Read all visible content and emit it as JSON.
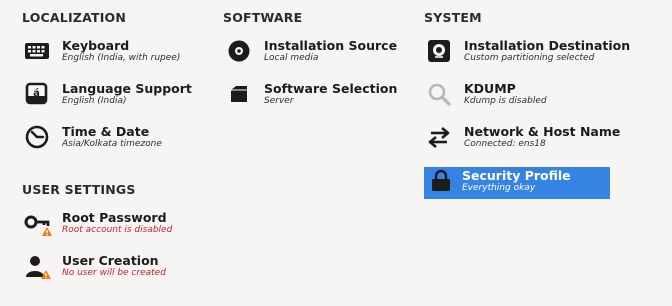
{
  "sections": {
    "localization": "LOCALIZATION",
    "software": "SOFTWARE",
    "system": "SYSTEM",
    "user_settings": "USER SETTINGS"
  },
  "spokes": {
    "keyboard": {
      "label": "Keyboard",
      "status": "English (India, with rupee)",
      "icon": "keyboard-icon"
    },
    "language": {
      "label": "Language Support",
      "status": "English (India)",
      "icon": "language-icon"
    },
    "time": {
      "label": "Time & Date",
      "status": "Asia/Kolkata timezone",
      "icon": "clock-icon"
    },
    "install_source": {
      "label": "Installation Source",
      "status": "Local media",
      "icon": "disc-icon"
    },
    "software_selection": {
      "label": "Software Selection",
      "status": "Server",
      "icon": "package-icon"
    },
    "install_dest": {
      "label": "Installation Destination",
      "status": "Custom partitioning selected",
      "icon": "drive-icon"
    },
    "kdump": {
      "label": "KDUMP",
      "status": "Kdump is disabled",
      "icon": "magnifier-icon"
    },
    "network": {
      "label": "Network & Host Name",
      "status": "Connected: ens18",
      "icon": "network-arrows-icon"
    },
    "security": {
      "label": "Security Profile",
      "status": "Everything okay",
      "icon": "lock-icon"
    },
    "root_password": {
      "label": "Root Password",
      "status": "Root account is disabled",
      "icon": "key-warning-icon"
    },
    "user_creation": {
      "label": "User Creation",
      "status": "No user will be created",
      "icon": "user-warning-icon"
    }
  },
  "colors": {
    "background": "#f6f5f4",
    "selected": "#3584e4",
    "warning_text": "#c4262e",
    "warning_badge": "#f57900"
  }
}
